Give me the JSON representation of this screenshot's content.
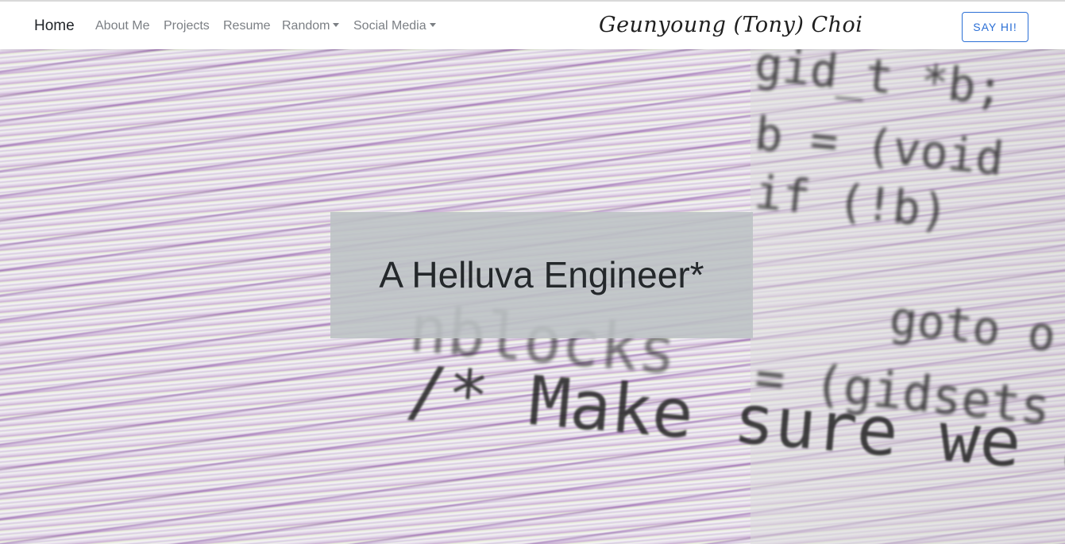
{
  "nav": {
    "home": "Home",
    "items": [
      {
        "label": "About Me"
      },
      {
        "label": "Projects"
      },
      {
        "label": "Resume"
      },
      {
        "label": "Random"
      },
      {
        "label": "Social Media"
      }
    ],
    "site_title": "Geunyoung (Tony) Choi",
    "cta": "SAY HI!"
  },
  "hero": {
    "headline": "A Helluva Engineer*",
    "background_code": {
      "line1": "gid_t *b;",
      "line2": "b = (void",
      "line3": "if (!b)",
      "line4": "goto o",
      "line5": "nblocks",
      "line6": "= (gidsets",
      "line7": "/* Make  sure we al"
    }
  },
  "colors": {
    "accent": "#2b6fd6",
    "nav_text": "#7b7f84",
    "headline_bg": "#bcc2c4"
  }
}
